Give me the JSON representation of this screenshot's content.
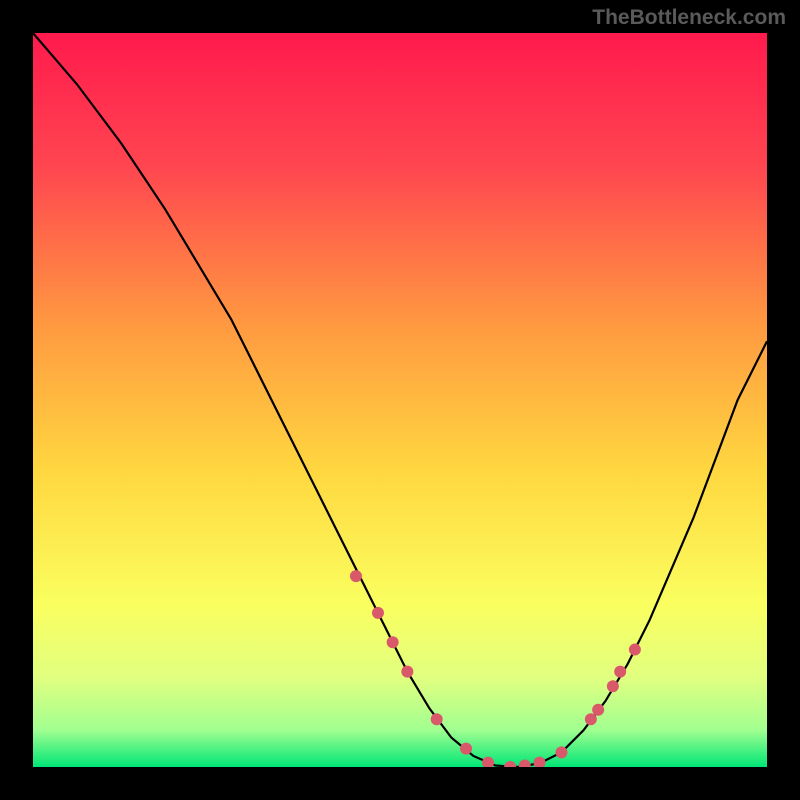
{
  "watermark": "TheBottleneck.com",
  "chart_data": {
    "type": "line",
    "title": "",
    "xlabel": "",
    "ylabel": "",
    "xlim": [
      0,
      100
    ],
    "ylim": [
      0,
      100
    ],
    "background_gradient": {
      "top": "#ff1a4d",
      "mid_high": "#ff8040",
      "mid": "#ffd840",
      "mid_low": "#faff60",
      "low": "#d8ff80",
      "bottom": "#00e676"
    },
    "curve": {
      "x": [
        0,
        3,
        6,
        9,
        12,
        15,
        18,
        21,
        24,
        27,
        30,
        33,
        36,
        39,
        42,
        45,
        48,
        51,
        54,
        57,
        60,
        63,
        66,
        69,
        72,
        75,
        78,
        81,
        84,
        87,
        90,
        93,
        96,
        100
      ],
      "y": [
        100,
        96.5,
        93,
        89,
        85,
        80.5,
        76,
        71,
        66,
        61,
        55,
        49,
        43,
        37,
        31,
        25,
        19,
        13,
        8,
        4,
        1.5,
        0.2,
        0,
        0.5,
        2,
        5,
        9,
        14,
        20,
        27,
        34,
        42,
        50,
        58
      ]
    },
    "markers": {
      "x": [
        44,
        47,
        49,
        51,
        55,
        59,
        62,
        65,
        67,
        69,
        72,
        76,
        77,
        79,
        80,
        82
      ],
      "y": [
        26,
        21,
        17,
        13,
        6.5,
        2.5,
        0.6,
        0,
        0.2,
        0.6,
        2,
        6.5,
        7.8,
        11,
        13,
        16
      ],
      "color": "#d9596a",
      "r": 6
    }
  }
}
